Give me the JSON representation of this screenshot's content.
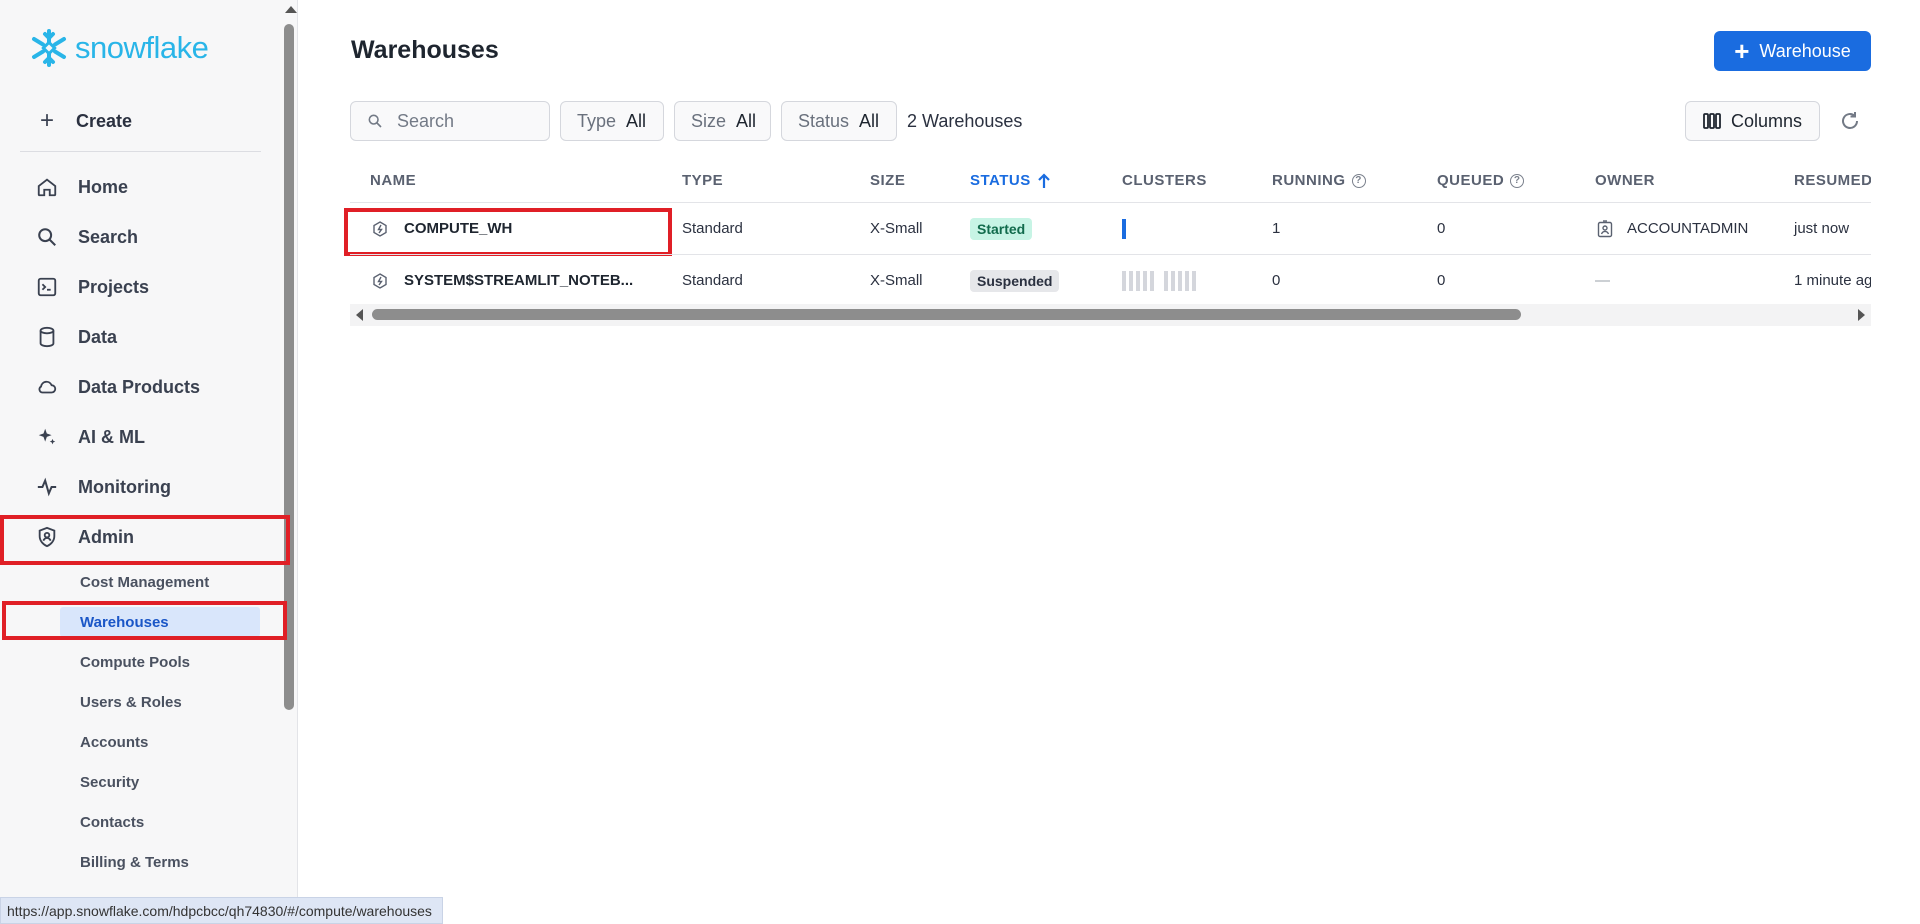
{
  "brand": {
    "name": "snowflake",
    "color": "#29b5e8"
  },
  "sidebar": {
    "create_label": "Create",
    "nav": [
      {
        "label": "Home",
        "icon": "home-icon"
      },
      {
        "label": "Search",
        "icon": "search-icon"
      },
      {
        "label": "Projects",
        "icon": "projects-icon"
      },
      {
        "label": "Data",
        "icon": "database-icon"
      },
      {
        "label": "Data Products",
        "icon": "cloud-icon"
      },
      {
        "label": "AI & ML",
        "icon": "sparkle-icon"
      },
      {
        "label": "Monitoring",
        "icon": "activity-icon"
      },
      {
        "label": "Admin",
        "icon": "shield-user-icon"
      }
    ],
    "admin_sub": [
      {
        "label": "Cost Management"
      },
      {
        "label": "Warehouses",
        "active": true
      },
      {
        "label": "Compute Pools"
      },
      {
        "label": "Users & Roles"
      },
      {
        "label": "Accounts"
      },
      {
        "label": "Security"
      },
      {
        "label": "Contacts"
      },
      {
        "label": "Billing & Terms"
      }
    ]
  },
  "main": {
    "title": "Warehouses",
    "add_button": "Warehouse",
    "search_placeholder": "Search",
    "filters": [
      {
        "label": "Type",
        "value": "All"
      },
      {
        "label": "Size",
        "value": "All"
      },
      {
        "label": "Status",
        "value": "All"
      }
    ],
    "count_label": "2 Warehouses",
    "columns_button": "Columns",
    "table": {
      "headers": [
        "NAME",
        "TYPE",
        "SIZE",
        "STATUS",
        "CLUSTERS",
        "RUNNING",
        "QUEUED",
        "OWNER",
        "RESUMED"
      ],
      "sorted_column": "STATUS",
      "rows": [
        {
          "name": "COMPUTE_WH",
          "type": "Standard",
          "size": "X-Small",
          "status": "Started",
          "clusters_active": 1,
          "running": "1",
          "queued": "0",
          "owner": "ACCOUNTADMIN",
          "resumed": "just now"
        },
        {
          "name": "SYSTEM$STREAMLIT_NOTEB...",
          "type": "Standard",
          "size": "X-Small",
          "status": "Suspended",
          "clusters_active": 0,
          "running": "0",
          "queued": "0",
          "owner": "—",
          "resumed": "1 minute ag"
        }
      ]
    }
  },
  "status_bar": {
    "url": "https://app.snowflake.com/hdpcbcc/qh74830/#/compute/warehouses"
  },
  "colors": {
    "accent": "#1a6ce0",
    "highlight": "#e01f26",
    "started_bg": "#c7f4e5",
    "active_nav_bg": "#d9e6fb"
  }
}
